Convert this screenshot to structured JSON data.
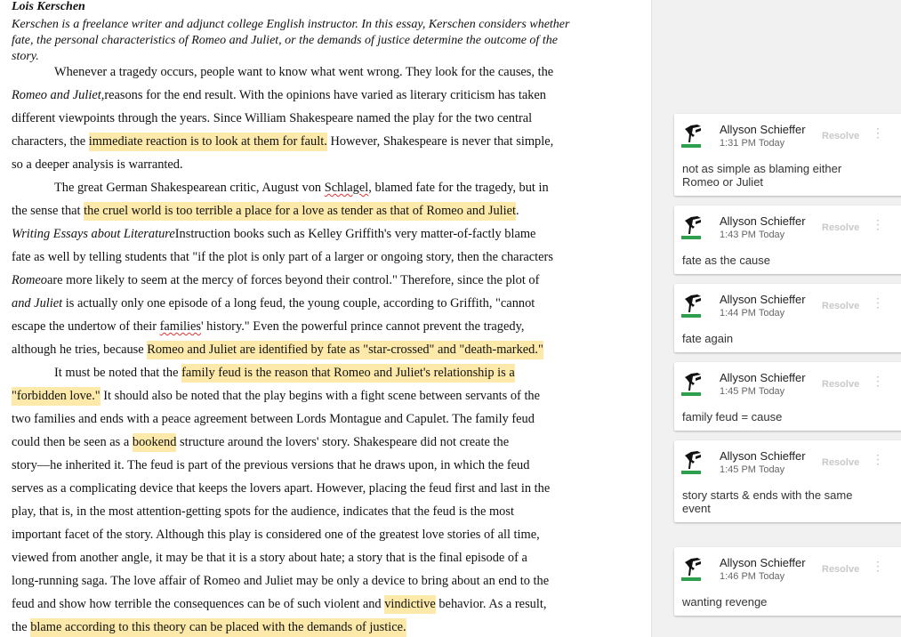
{
  "document": {
    "author": "Lois Kerschen",
    "intro": "Kerschen is a freelance writer and adjunct college English instructor. In this essay, Kerschen considers whether fate, the personal characteristics of Romeo and Juliet, or the demands of justice determine the outcome of the story.",
    "lines": [
      {
        "t": "Whenever a tragedy occurs, people want to know what went wrong. They look for the causes, the"
      },
      {
        "t1": "reasons for the end result. With ",
        "i": "Romeo and Juliet,",
        "t2": " the opinions have varied as literary criticism has taken"
      },
      {
        "t": "different viewpoints through the years. Since William Shakespeare named the play for the two central"
      },
      {
        "t1": "characters, the ",
        "h": "immediate reaction is to look at them for fault.",
        "t2": " However, Shakespeare is never that simple,"
      },
      {
        "t": "so a deeper analysis is warranted."
      },
      {
        "t1": "The great German Shakespearean critic, August von ",
        "s": "Schlagel",
        "t2": ", blamed fate for the tragedy, but in"
      },
      {
        "t1": "the sense that ",
        "h": "the cruel world is too terrible a place for a love as tender as that of Romeo and Juliet",
        "t2": "."
      },
      {
        "t1": "Instruction books such as Kelley Griffith's ",
        "i": "Writing Essays about Literature",
        "t2": " very matter-of-factly blame"
      },
      {
        "t": "fate as well by telling students that \"if the plot is only part of a larger or ongoing story, then the characters"
      },
      {
        "t1": "are more likely to seem at the mercy of forces beyond their control.\" Therefore, since the plot of ",
        "i": "Romeo"
      },
      {
        "i": "and Juliet",
        "t2": " is actually only one episode of a long feud, the young couple, according to Griffith, \"cannot"
      },
      {
        "t1": "escape the undertow of their ",
        "s": "families",
        "t2": "' history.\" Even the powerful prince cannot prevent the tragedy,"
      },
      {
        "t1": "although he tries, because ",
        "h": "Romeo and Juliet are identified by fate as \"star-crossed\" and \"death-marked.\""
      },
      {
        "t1": "It must be noted that the ",
        "h": "family feud is the reason that Romeo and Juliet's relationship is a"
      },
      {
        "h0": "\"forbidden love.\"",
        "t2": " It should also be noted that the play begins with a fight scene between servants of the"
      },
      {
        "t": "two families and ends with a peace agreement between Lords Montague and Capulet. The family feud"
      },
      {
        "t1": "could then be seen as a ",
        "h": "bookend",
        "t2": " structure around the lovers' story. Shakespeare did not create the"
      },
      {
        "t": "story—he inherited it. The feud is part of the previous versions that he draws upon, in which the feud"
      },
      {
        "t": "serves as a complicating device that keeps the lovers apart. However, placing the feud first and last in the"
      },
      {
        "t": "play, that is, in the most attention-getting spots for the audience, indicates that the feud is the most"
      },
      {
        "t": "important facet of the story. Although this play is considered one of the greatest love stories of all time,"
      },
      {
        "t": "viewed from another angle, it may be that it is a story about hate; a story that is the final episode of a"
      },
      {
        "t": "long-running saga. The love affair of Romeo and Juliet may be only a device to bring about an end to the"
      },
      {
        "t1": "feud and show how terrible the consequences can be of such violent and ",
        "h": "vindictive",
        "t2": " behavior. As a result,"
      },
      {
        "t1": "the ",
        "h": "blame according to this theory can be placed with the demands of justice."
      }
    ]
  },
  "comments": [
    {
      "author": "Allyson Schieffer",
      "time": "1:31 PM Today",
      "resolve": "Resolve",
      "text": "not as simple as blaming either Romeo or Juliet"
    },
    {
      "author": "Allyson Schieffer",
      "time": "1:43 PM Today",
      "resolve": "Resolve",
      "text": "fate as the cause"
    },
    {
      "author": "Allyson Schieffer",
      "time": "1:44 PM Today",
      "resolve": "Resolve",
      "text": "fate again"
    },
    {
      "author": "Allyson Schieffer",
      "time": "1:45 PM Today",
      "resolve": "Resolve",
      "text": "family feud = cause"
    },
    {
      "author": "Allyson Schieffer",
      "time": "1:45 PM Today",
      "resolve": "Resolve",
      "text": "story starts & ends with the same event"
    },
    {
      "author": "Allyson Schieffer",
      "time": "1:46 PM Today",
      "resolve": "Resolve",
      "text": "wanting revenge"
    }
  ],
  "colors": {
    "highlight": "#fde9a9",
    "avatar_green": "#2e9e4f"
  }
}
